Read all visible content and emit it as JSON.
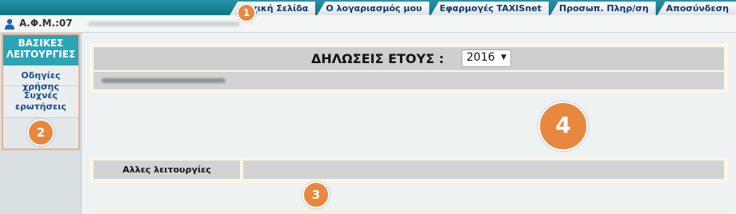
{
  "topnav": {
    "items": [
      {
        "label": "Αρχική Σελίδα"
      },
      {
        "label": "Ο λογαριασμός μου"
      },
      {
        "label": "Εφαρμογές TAXISnet"
      },
      {
        "label": "Προσωπ. Πληρ/ση"
      },
      {
        "label": "Αποσύνδεση"
      }
    ]
  },
  "user": {
    "afm_label": "Α.Φ.Μ.:07",
    "icon": "user-icon"
  },
  "sidebar": {
    "header": "ΒΑΣΙΚΕΣ ΛΕΙΤΟΥΡΓΙΕΣ",
    "items": [
      {
        "label": "Οδηγίες χρήσης"
      },
      {
        "label": "Συχνές ερωτήσεις"
      }
    ]
  },
  "main": {
    "title": "ΔΗΛΩΣΕΙΣ ΕΤΟΥΣ :",
    "year_selected": "2016",
    "other_label": "Αλλες λειτουργίες"
  },
  "markers": [
    "1",
    "2",
    "3",
    "4"
  ],
  "colors": {
    "topbar": "#0f7285",
    "sidebar_header": "#2aa5b5",
    "link": "#1a4f86",
    "marker": "#e8883f",
    "panel_gray": "#d3d3d3"
  }
}
